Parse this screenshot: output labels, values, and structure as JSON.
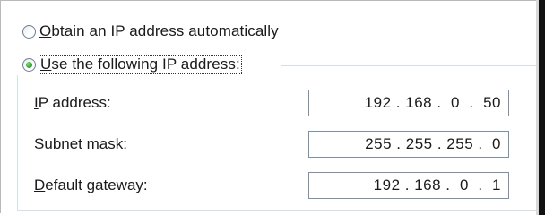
{
  "options": {
    "auto": {
      "label_prefix": "",
      "underline_char": "O",
      "label_rest": "btain an IP address automatically",
      "checked": false
    },
    "manual": {
      "label_prefix": "",
      "underline_char": "U",
      "label_rest": "se the following IP address:",
      "checked": true
    }
  },
  "fields": [
    {
      "label_prefix": "",
      "underline_char": "I",
      "label_rest": "P address:",
      "value": "192 . 168 .  0  .  50"
    },
    {
      "label_prefix": "S",
      "underline_char": "u",
      "label_rest": "bnet mask:",
      "value": "255 . 255 . 255 .  0"
    },
    {
      "label_prefix": "",
      "underline_char": "D",
      "label_rest": "efault gateway:",
      "value": "192 . 168 .  0  .  1"
    }
  ]
}
